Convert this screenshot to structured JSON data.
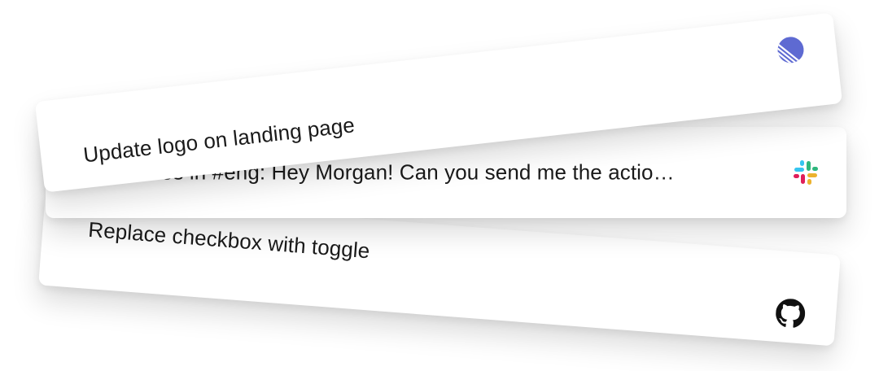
{
  "notifications": [
    {
      "id": "github",
      "text": "Replace checkbox with toggle",
      "icon": "github-icon"
    },
    {
      "id": "slack",
      "text": "From Jules in #eng: Hey Morgan! Can you send me the actio…",
      "icon": "slack-icon"
    },
    {
      "id": "linear",
      "text": "Update logo on landing page",
      "icon": "linear-icon",
      "accent": "#5e6ad2"
    }
  ]
}
